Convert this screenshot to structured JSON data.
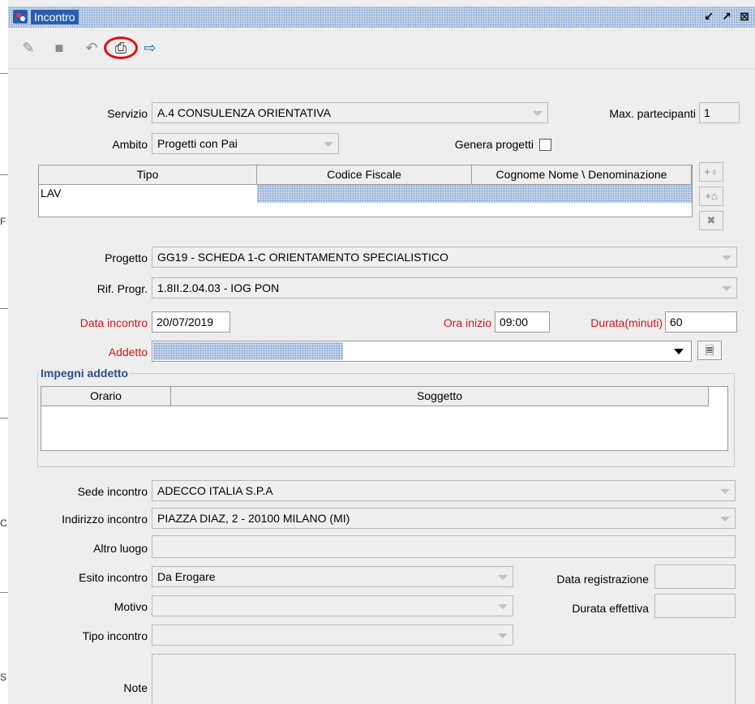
{
  "window": {
    "title": "Incontro",
    "controls": [
      "restore-icon",
      "maximize-icon",
      "close-icon"
    ]
  },
  "left_strip_chars": [
    "F",
    "C",
    "S"
  ],
  "toolbar": {
    "icons": [
      "edit-icon",
      "save-icon",
      "undo-icon",
      "print-icon",
      "exit-icon"
    ],
    "highlight": "print-icon",
    "highlight_color": "#e01010"
  },
  "form": {
    "servizio": {
      "label": "Servizio",
      "value": "A.4 CONSULENZA ORIENTATIVA"
    },
    "max_partecipanti": {
      "label": "Max. partecipanti",
      "value": "1"
    },
    "ambito": {
      "label": "Ambito",
      "value": "Progetti con Pai"
    },
    "genera_progetti": {
      "label": "Genera progetti",
      "checked": false
    },
    "table": {
      "headers": [
        "Tipo",
        "Codice Fiscale",
        "Cognome Nome \\ Denominazione"
      ],
      "rows": [
        [
          "LAV",
          "",
          ""
        ]
      ]
    },
    "side_buttons": [
      "add-person-icon",
      "add-company-icon",
      "remove-icon"
    ],
    "progetto": {
      "label": "Progetto",
      "value": "GG19 - SCHEDA 1-C ORIENTAMENTO SPECIALISTICO"
    },
    "rif_progr": {
      "label": "Rif. Progr.",
      "value": "1.8II.2.04.03 - IOG PON"
    },
    "data_incontro": {
      "label": "Data incontro",
      "value": "20/07/2019"
    },
    "ora_inizio": {
      "label": "Ora inizio",
      "value": "09:00"
    },
    "durata": {
      "label": "Durata(minuti)",
      "value": "60"
    },
    "addetto": {
      "label": "Addetto",
      "value": ""
    },
    "impegni": {
      "title": "Impegni addetto",
      "headers": [
        "Orario",
        "Soggetto"
      ]
    },
    "sede_incontro": {
      "label": "Sede incontro",
      "value": "ADECCO ITALIA S.P.A"
    },
    "indirizzo_incontro": {
      "label": "Indirizzo incontro",
      "value": "PIAZZA DIAZ, 2 - 20100 MILANO (MI)"
    },
    "altro_luogo": {
      "label": "Altro luogo",
      "value": ""
    },
    "esito_incontro": {
      "label": "Esito incontro",
      "value": "Da Erogare"
    },
    "data_registrazione": {
      "label": "Data registrazione",
      "value": ""
    },
    "motivo": {
      "label": "Motivo",
      "value": ""
    },
    "durata_effettiva": {
      "label": "Durata effettiva",
      "value": ""
    },
    "tipo_incontro": {
      "label": "Tipo incontro",
      "value": ""
    },
    "note": {
      "label": "Note",
      "value": ""
    }
  },
  "colors": {
    "required_label": "#d0161b",
    "group_title": "#2e4e8e",
    "title_bar": "#2a5db0",
    "background": "#eeeeee"
  }
}
